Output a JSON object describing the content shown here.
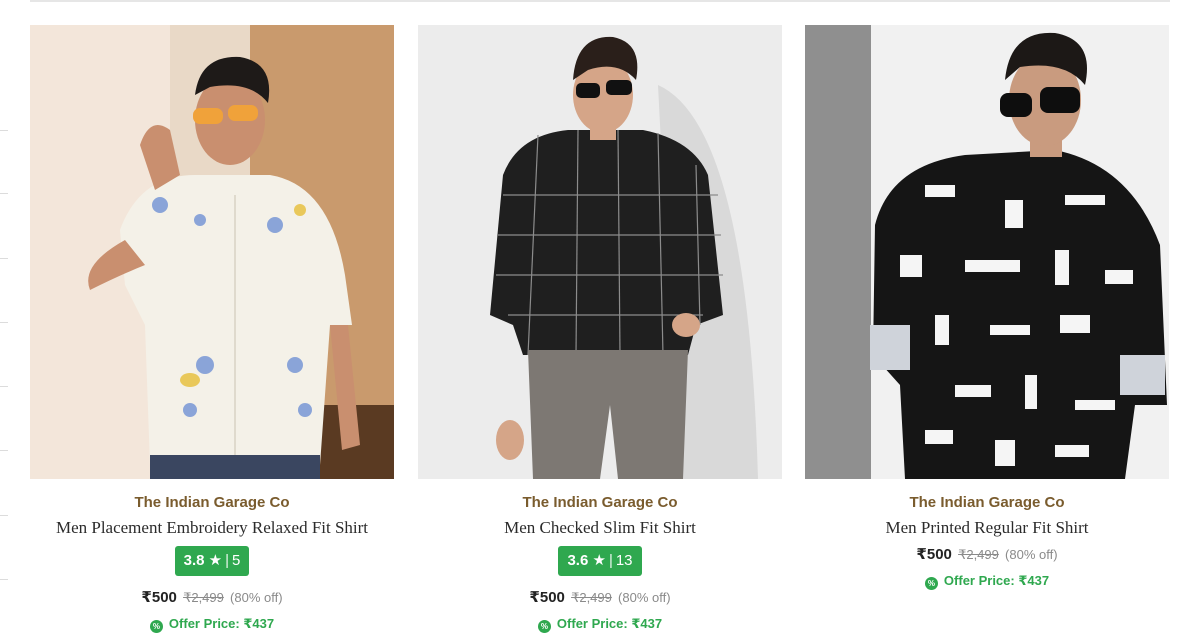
{
  "products": [
    {
      "brand": "The Indian Garage Co",
      "name": "Men Placement Embroidery Relaxed Fit Shirt",
      "rating_value": "3.8",
      "rating_star": "★",
      "rating_count": "5",
      "price": "₹500",
      "mrp": "₹2,499",
      "discount": "(80% off)",
      "offer_price": "Offer Price: ₹437",
      "image": "white-embroidered-shirt-model"
    },
    {
      "brand": "The Indian Garage Co",
      "name": "Men Checked Slim Fit Shirt",
      "rating_value": "3.6",
      "rating_star": "★",
      "rating_count": "13",
      "price": "₹500",
      "mrp": "₹2,499",
      "discount": "(80% off)",
      "offer_price": "Offer Price: ₹437",
      "image": "black-checked-shirt-model"
    },
    {
      "brand": "The Indian Garage Co",
      "name": "Men Printed Regular Fit Shirt",
      "price": "₹500",
      "mrp": "₹2,499",
      "discount": "(80% off)",
      "offer_price": "Offer Price: ₹437",
      "image": "black-printed-shirt-model"
    }
  ],
  "colors": {
    "brand_text": "#7a5c2e",
    "rating_bg": "#2fa84f",
    "offer_green": "#2fa84f"
  },
  "icons": {
    "offer": "percent-badge-icon",
    "rating": "star-icon"
  }
}
